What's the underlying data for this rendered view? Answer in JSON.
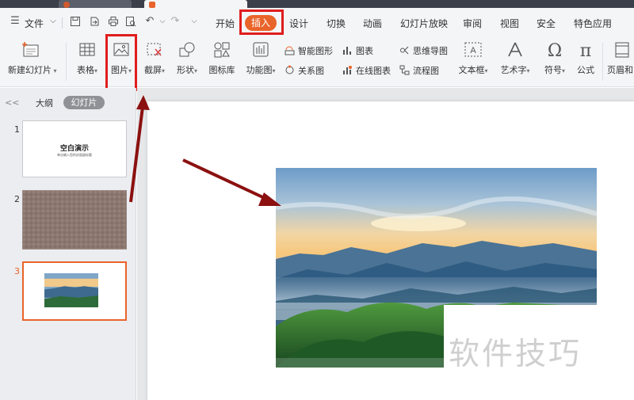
{
  "menu": {
    "file": "文件",
    "tabs": [
      "开始",
      "插入",
      "设计",
      "切换",
      "动画",
      "幻灯片放映",
      "审阅",
      "视图",
      "安全",
      "特色应用"
    ],
    "active_tab": "插入"
  },
  "ribbon": {
    "new_slide": "新建幻灯片",
    "table": "表格",
    "picture": "图片",
    "screenshot": "截屏",
    "shapes": "形状",
    "icon_library": "图标库",
    "function_chart": "功能图",
    "smart_graphic": "智能图形",
    "chart": "图表",
    "mind_map": "思维导图",
    "relation_chart": "关系图",
    "online_chart": "在线图表",
    "flowchart": "流程图",
    "textbox": "文本框",
    "art_text": "艺术字",
    "symbol": "符号",
    "formula": "公式",
    "header_footer": "页眉和"
  },
  "panel": {
    "collapse": "<<",
    "outline_tab": "大纲",
    "slides_tab": "幻灯片",
    "slides": [
      {
        "number": "1",
        "title": "空白演示",
        "subtitle": "单击输入您的封面副标题"
      },
      {
        "number": "2"
      },
      {
        "number": "3"
      }
    ],
    "active_slide": "3"
  },
  "watermark": "软件技巧",
  "colors": {
    "accent": "#e9642a",
    "highlight_box": "#e01d1d",
    "arrow": "#8b1010"
  }
}
